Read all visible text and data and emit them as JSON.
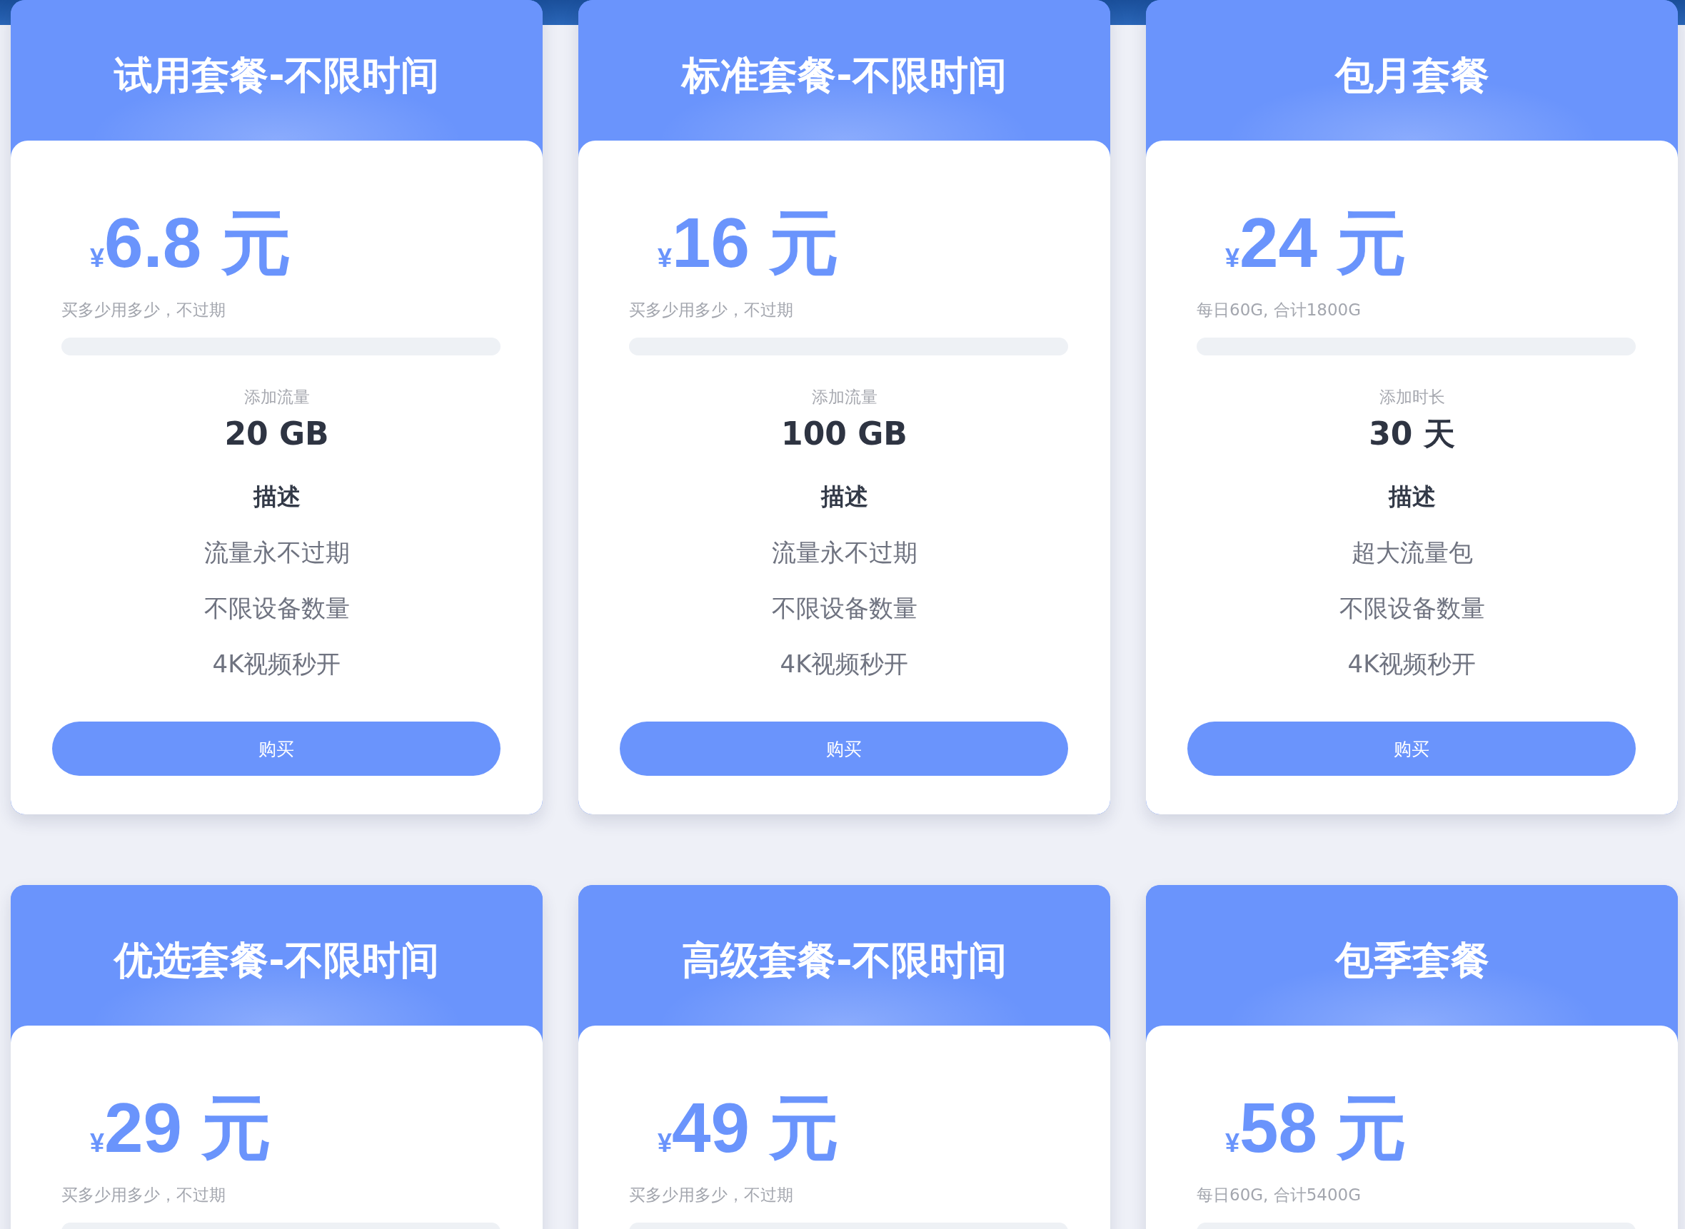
{
  "plans": [
    {
      "title": "试用套餐-不限时间",
      "price": {
        "currency": "¥",
        "amount": "6.8",
        "unit": "元"
      },
      "note": "买多少用多少，不过期",
      "quota_label": "添加流量",
      "quota": "20 GB",
      "description_title": "描述",
      "features": [
        "流量永不过期",
        "不限设备数量",
        "4K视频秒开"
      ],
      "button": "购买"
    },
    {
      "title": "标准套餐-不限时间",
      "price": {
        "currency": "¥",
        "amount": "16",
        "unit": "元"
      },
      "note": "买多少用多少，不过期",
      "quota_label": "添加流量",
      "quota": "100 GB",
      "description_title": "描述",
      "features": [
        "流量永不过期",
        "不限设备数量",
        "4K视频秒开"
      ],
      "button": "购买"
    },
    {
      "title": "包月套餐",
      "price": {
        "currency": "¥",
        "amount": "24",
        "unit": "元"
      },
      "note": "每日60G, 合计1800G",
      "quota_label": "添加时长",
      "quota": "30 天",
      "description_title": "描述",
      "features": [
        "超大流量包",
        "不限设备数量",
        "4K视频秒开"
      ],
      "button": "购买"
    },
    {
      "title": "优选套餐-不限时间",
      "price": {
        "currency": "¥",
        "amount": "29",
        "unit": "元"
      },
      "note": "买多少用多少，不过期"
    },
    {
      "title": "高级套餐-不限时间",
      "price": {
        "currency": "¥",
        "amount": "49",
        "unit": "元"
      },
      "note": "买多少用多少，不过期"
    },
    {
      "title": "包季套餐",
      "price": {
        "currency": "¥",
        "amount": "58",
        "unit": "元"
      },
      "note": "每日60G, 合计5400G"
    }
  ]
}
